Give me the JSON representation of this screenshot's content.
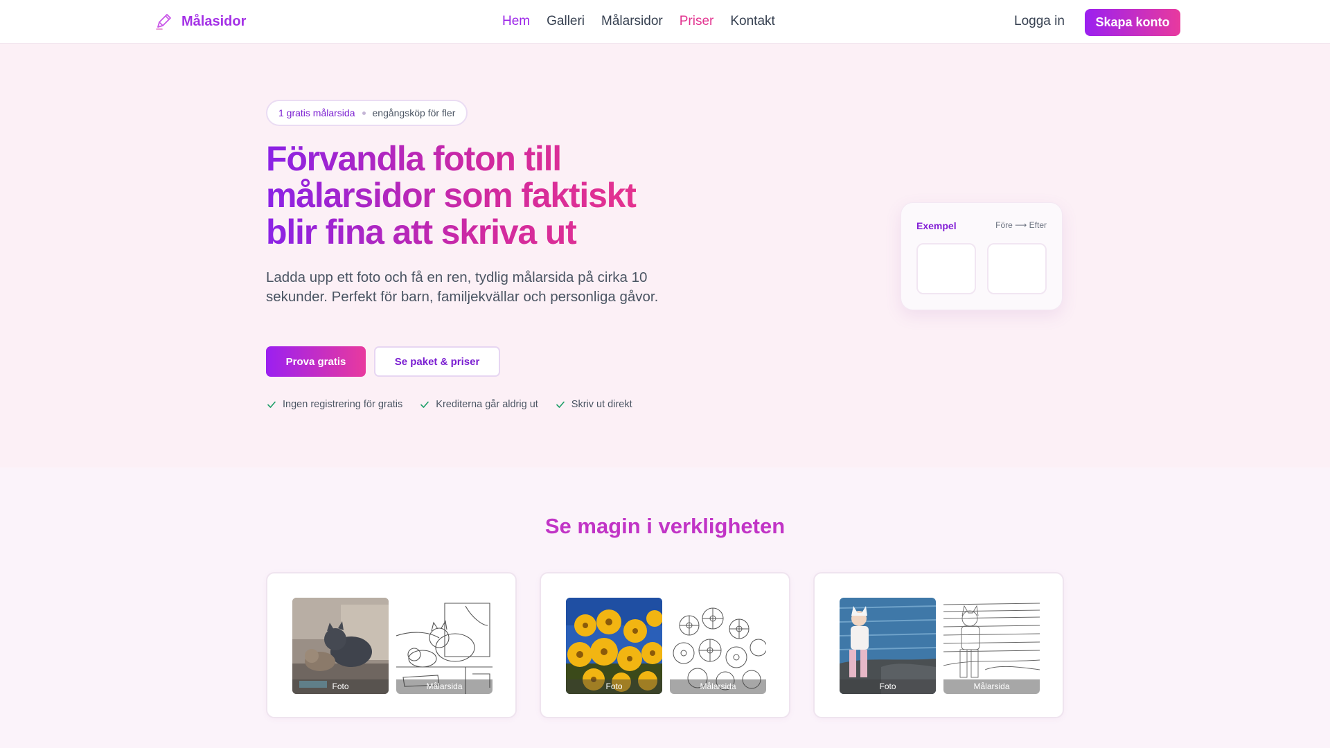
{
  "nav": {
    "brand": "Målasidor",
    "links": [
      "Hem",
      "Galleri",
      "Målarsidor",
      "Priser",
      "Kontakt"
    ],
    "login": "Logga in",
    "signup": "Skapa konto"
  },
  "hero": {
    "pill_primary": "1 gratis målarsida",
    "pill_secondary": "engångsköp för fler",
    "headline": "Förvandla foton till målarsidor som faktiskt blir fina att skriva ut",
    "lead": "Ladda upp ett foto och få en ren, tydlig målarsida på cirka 10 sekunder. Perfekt för barn, familjekvällar och personliga gåvor.",
    "cta_primary": "Prova gratis",
    "cta_secondary": "Se paket & priser",
    "checks": [
      "Ingen registrering för gratis",
      "Krediterna går aldrig ut",
      "Skriv ut direkt"
    ]
  },
  "example_card": {
    "title": "Exempel",
    "meta": "Före ⟶ Efter"
  },
  "showcase": {
    "title": "Se magin i verkligheten",
    "photo_label": "Foto",
    "page_label": "Målarsida"
  },
  "colors": {
    "accent_purple": "#9b20f0",
    "accent_pink": "#e83a9e",
    "hero_bg": "#fcf0f6"
  }
}
